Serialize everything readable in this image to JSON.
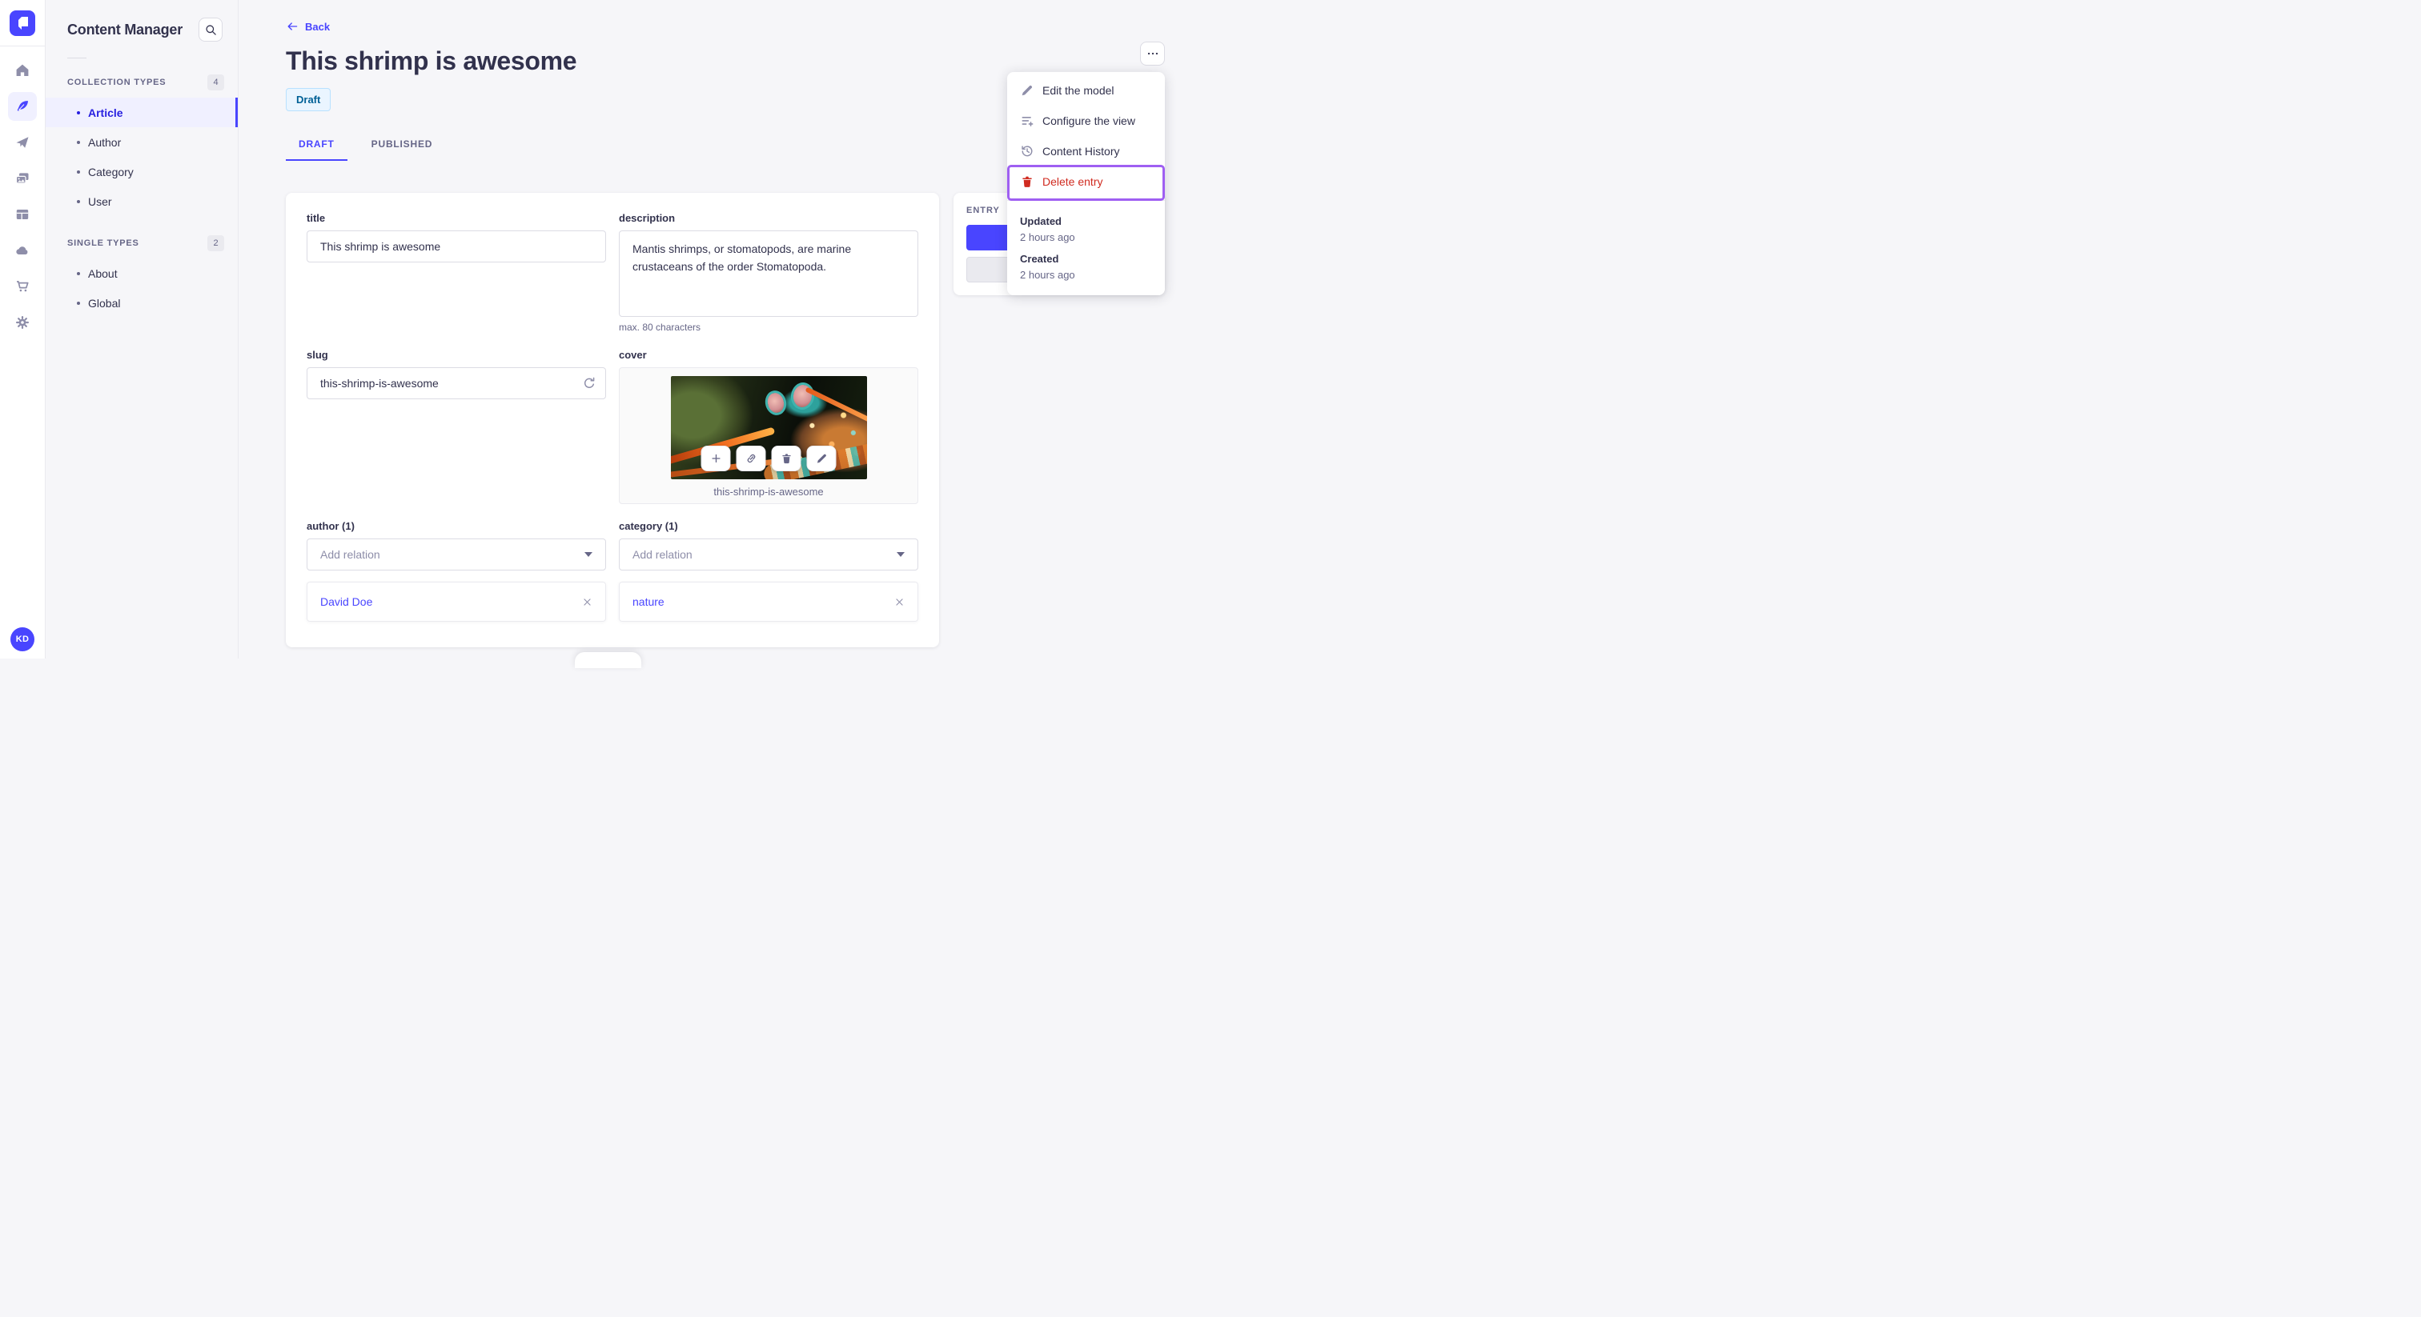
{
  "colors": {
    "accent": "#4945ff",
    "accent_light_bg": "#f0f0ff",
    "danger": "#d02b20",
    "annotation_purple": "#9f5ff2",
    "draft_bg": "#eaf5ff",
    "draft_text": "#006096",
    "page_bg": "#f6f6f9"
  },
  "rail": {
    "logo_icon": "strapi-logo",
    "icons": [
      "home-icon",
      "feather-icon",
      "paper-plane-icon",
      "media-icon",
      "layout-icon",
      "cloud-icon",
      "cart-icon",
      "gear-icon"
    ],
    "avatar_initials": "KD"
  },
  "sidebar": {
    "title": "Content Manager",
    "search_icon": "search-icon",
    "sections": [
      {
        "label": "COLLECTION TYPES",
        "count": "4",
        "items": [
          {
            "label": "Article",
            "active": true
          },
          {
            "label": "Author"
          },
          {
            "label": "Category"
          },
          {
            "label": "User"
          }
        ]
      },
      {
        "label": "SINGLE TYPES",
        "count": "2",
        "items": [
          {
            "label": "About"
          },
          {
            "label": "Global"
          }
        ]
      }
    ]
  },
  "header": {
    "back_label": "Back",
    "title": "This shrimp is awesome",
    "status_badge": "Draft",
    "tabs": [
      {
        "label": "DRAFT",
        "active": true
      },
      {
        "label": "PUBLISHED"
      }
    ]
  },
  "form": {
    "title": {
      "label": "title",
      "value": "This shrimp is awesome"
    },
    "description": {
      "label": "description",
      "value": "Mantis shrimps, or stomatopods, are marine crustaceans of the order Stomatopoda.",
      "hint": "max. 80 characters"
    },
    "slug": {
      "label": "slug",
      "value": "this-shrimp-is-awesome",
      "action_icon": "refresh-icon"
    },
    "cover": {
      "label": "cover",
      "caption": "this-shrimp-is-awesome",
      "action_icons": [
        "plus-icon",
        "link-icon",
        "trash-icon",
        "pencil-icon"
      ]
    },
    "author": {
      "label": "author (1)",
      "placeholder": "Add relation",
      "relation": "David Doe"
    },
    "category": {
      "label": "category (1)",
      "placeholder": "Add relation",
      "relation": "nature"
    }
  },
  "entry_panel": {
    "title": "ENTRY"
  },
  "menu": {
    "trigger_icon": "ellipsis-icon",
    "items": [
      {
        "label": "Edit the model",
        "icon": "pencil-icon"
      },
      {
        "label": "Configure the view",
        "icon": "configure-list-icon"
      },
      {
        "label": "Content History",
        "icon": "history-icon"
      },
      {
        "label": "Delete entry",
        "icon": "trash-icon",
        "danger": true,
        "highlighted": true
      }
    ],
    "meta": [
      {
        "label": "Updated",
        "value": "2 hours ago"
      },
      {
        "label": "Created",
        "value": "2 hours ago"
      }
    ]
  }
}
